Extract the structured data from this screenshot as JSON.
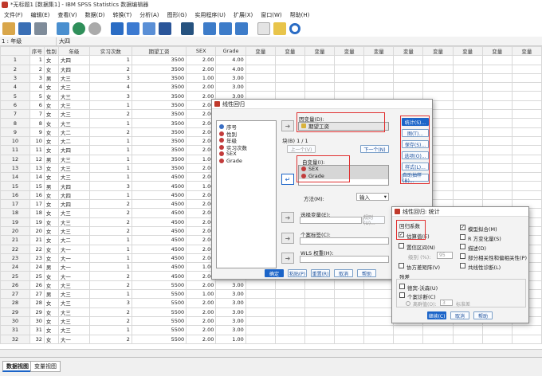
{
  "window": {
    "title": "*无标题1 [数据集1] - IBM SPSS Statistics 数据编辑器"
  },
  "menu": [
    "文件(F)",
    "编辑(E)",
    "查看(V)",
    "数据(D)",
    "转换(T)",
    "分析(A)",
    "图形(G)",
    "实用程序(U)",
    "扩展(X)",
    "窗口(W)",
    "帮助(H)"
  ],
  "cellref": {
    "name": "1 : 年级",
    "value": "大四"
  },
  "grid": {
    "headers": [
      "序号",
      "性别",
      "年级",
      "实习次数",
      "期望工资",
      "SEX",
      "Grade",
      "变量",
      "变量",
      "变量",
      "变量",
      "变量",
      "变量",
      "变量",
      "变量",
      "变量",
      "变量"
    ],
    "rows": [
      [
        "1",
        "1",
        "女",
        "大四",
        "1",
        "3500",
        "2.00",
        "4.00"
      ],
      [
        "2",
        "2",
        "女",
        "大四",
        "2",
        "3500",
        "2.00",
        "4.00"
      ],
      [
        "3",
        "3",
        "男",
        "大三",
        "3",
        "3500",
        "1.00",
        "3.00"
      ],
      [
        "4",
        "4",
        "女",
        "大三",
        "4",
        "3500",
        "2.00",
        "3.00"
      ],
      [
        "5",
        "5",
        "女",
        "大三",
        "3",
        "3500",
        "2.00",
        "3.00"
      ],
      [
        "6",
        "6",
        "女",
        "大三",
        "1",
        "3500",
        "2.00",
        "3.00"
      ],
      [
        "7",
        "7",
        "女",
        "大三",
        "2",
        "3500",
        "2.00",
        "3.00"
      ],
      [
        "8",
        "8",
        "女",
        "大三",
        "1",
        "3500",
        "2.00",
        "3.00"
      ],
      [
        "9",
        "9",
        "女",
        "大二",
        "2",
        "3500",
        "2.00",
        "2.00"
      ],
      [
        "10",
        "10",
        "女",
        "大二",
        "1",
        "3500",
        "2.00",
        "2.00"
      ],
      [
        "11",
        "11",
        "女",
        "大四",
        "1",
        "3500",
        "2.00",
        "4.00"
      ],
      [
        "12",
        "12",
        "男",
        "大三",
        "1",
        "3500",
        "1.00",
        "3.00"
      ],
      [
        "13",
        "13",
        "女",
        "大三",
        "1",
        "3500",
        "2.00",
        "3.00"
      ],
      [
        "14",
        "14",
        "女",
        "大三",
        "1",
        "4500",
        "2.00",
        "3.00"
      ],
      [
        "15",
        "15",
        "男",
        "大四",
        "3",
        "4500",
        "1.00",
        "4.00"
      ],
      [
        "16",
        "16",
        "女",
        "大四",
        "1",
        "4500",
        "2.00",
        "4.00"
      ],
      [
        "17",
        "17",
        "女",
        "大四",
        "2",
        "4500",
        "2.00",
        "4.00"
      ],
      [
        "18",
        "18",
        "女",
        "大三",
        "2",
        "4500",
        "2.00",
        "3.00"
      ],
      [
        "19",
        "19",
        "女",
        "大三",
        "2",
        "4500",
        "2.00",
        "3.00"
      ],
      [
        "20",
        "20",
        "女",
        "大三",
        "2",
        "4500",
        "2.00",
        "3.00"
      ],
      [
        "21",
        "21",
        "女",
        "大二",
        "1",
        "4500",
        "2.00",
        "2.00"
      ],
      [
        "22",
        "22",
        "女",
        "大一",
        "1",
        "4500",
        "2.00",
        "1.00"
      ],
      [
        "23",
        "23",
        "女",
        "大一",
        "1",
        "4500",
        "2.00",
        "1.00"
      ],
      [
        "24",
        "24",
        "男",
        "大一",
        "1",
        "4500",
        "1.00",
        "1.00"
      ],
      [
        "25",
        "25",
        "女",
        "大一",
        "2",
        "4500",
        "2.00",
        "1.00"
      ],
      [
        "26",
        "26",
        "女",
        "大三",
        "2",
        "5500",
        "2.00",
        "3.00"
      ],
      [
        "27",
        "27",
        "男",
        "大三",
        "1",
        "5500",
        "1.00",
        "3.00"
      ],
      [
        "28",
        "28",
        "女",
        "大三",
        "3",
        "5500",
        "2.00",
        "3.00"
      ],
      [
        "29",
        "29",
        "女",
        "大三",
        "2",
        "5500",
        "2.00",
        "3.00"
      ],
      [
        "30",
        "30",
        "女",
        "大三",
        "2",
        "5500",
        "2.00",
        "3.00"
      ],
      [
        "31",
        "31",
        "女",
        "大三",
        "1",
        "5500",
        "2.00",
        "3.00"
      ],
      [
        "32",
        "32",
        "女",
        "大一",
        "2",
        "5500",
        "2.00",
        "1.00"
      ]
    ]
  },
  "tabs": {
    "data_view": "数据视图",
    "variable_view": "变量视图"
  },
  "regression": {
    "title": "线性回归",
    "source_vars": [
      "序号",
      "性别",
      "年级",
      "实习次数",
      "SEX",
      "Grade"
    ],
    "dependent_label": "因变量(D):",
    "dependent_value": "期望工资",
    "block_label": "块(B) 1 / 1",
    "prev": "上一个(V)",
    "next": "下一个(N)",
    "independent_label": "自变量(I):",
    "independent_vars": [
      "SEX",
      "Grade"
    ],
    "method_label": "方法(M):",
    "method_value": "输入",
    "selection_label": "选择变量(E):",
    "rule_button": "规则(U)...",
    "case_label": "个案标签(C):",
    "wls_label": "WLS 权重(H):",
    "side_buttons": [
      "统计(S)...",
      "图(T)...",
      "保存(S)...",
      "选项(O)...",
      "样式(L)...",
      "自助抽样(B)..."
    ],
    "bottom_buttons": [
      "确定",
      "粘贴(P)",
      "重置(R)",
      "取消",
      "帮助"
    ]
  },
  "stats": {
    "title": "线性回归: 统计",
    "coef_header": "回归系数",
    "estimate": "估算值(E)",
    "confidence": "置信区间(N)",
    "level_label": "级别 (%):",
    "level_value": "95",
    "covariance": "协方差矩阵(V)",
    "model_fit": "模型拟合(M)",
    "r_change": "R 方变化量(S)",
    "descriptives": "描述(D)",
    "part_partial": "部分相关性和偏相关性(P)",
    "collinearity": "共线性诊断(L)",
    "residuals_header": "残差",
    "durbin": "德宾-沃森(U)",
    "casewise": "个案诊断(C)",
    "outliers": "离群值(O):",
    "outliers_value": "3",
    "sd_label": "标准差",
    "all_cases": "所有个案(A)",
    "buttons": [
      "继续(C)",
      "取消",
      "帮助"
    ]
  }
}
